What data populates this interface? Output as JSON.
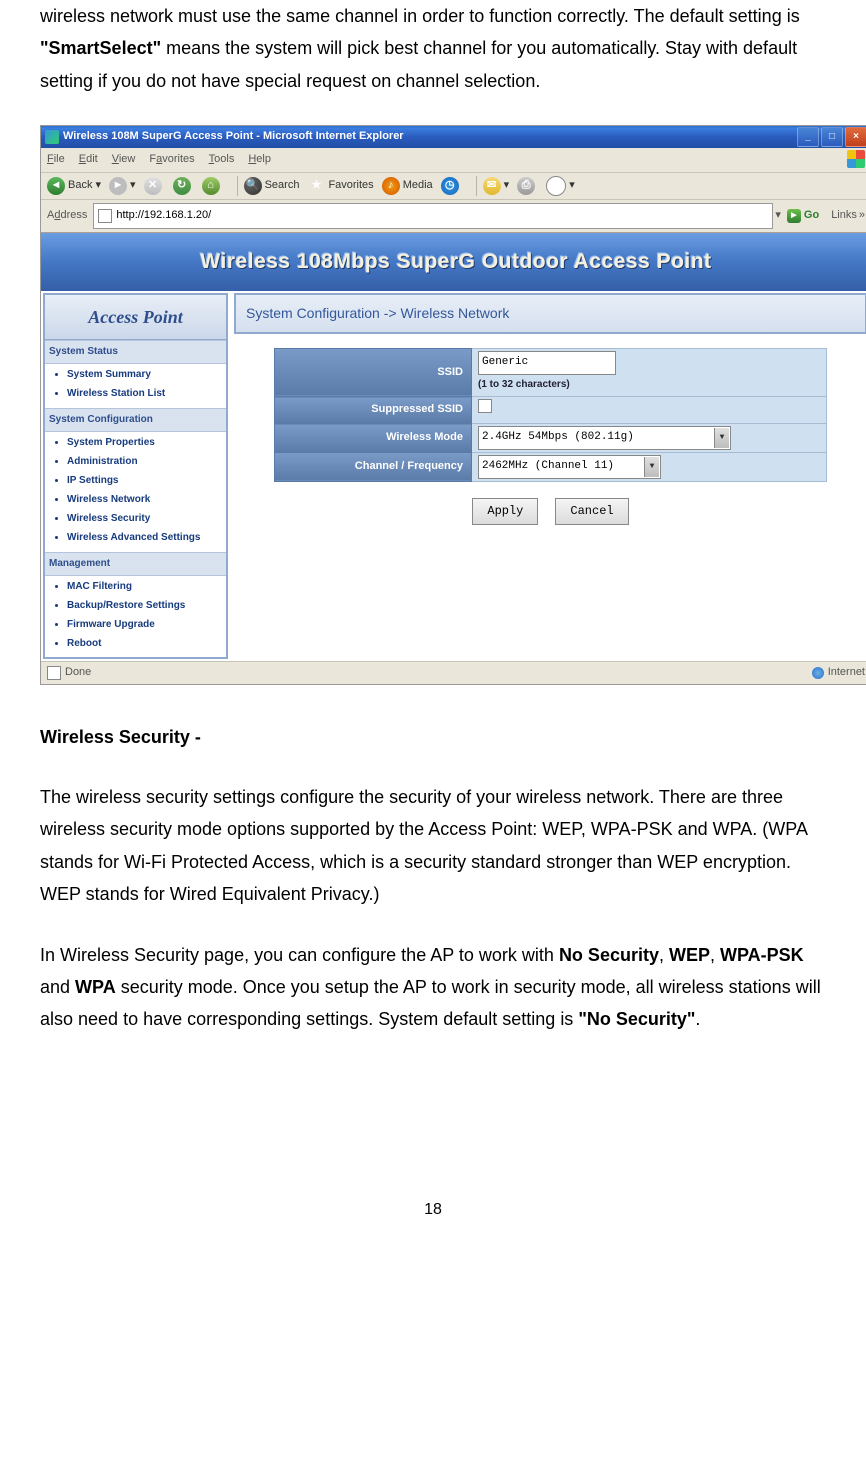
{
  "doc": {
    "intro_pre": "wireless network must use the same channel in order to function correctly. The default setting is ",
    "intro_bold1": "\"SmartSelect\"",
    "intro_post": " means the system will pick best channel for you automatically. Stay with default setting if you do not have special request on channel selection.",
    "heading": "Wireless Security -",
    "para2": "The wireless security settings configure the security of your wireless network. There are three wireless security mode options supported by the Access Point: WEP, WPA-PSK and WPA. (WPA stands for Wi-Fi Protected Access, which is a security standard stronger than WEP encryption. WEP stands for Wired Equivalent Privacy.)",
    "para3_pre": "In Wireless Security page, you can configure the AP to work with ",
    "para3_b1": "No Security",
    "para3_s1": ", ",
    "para3_b2": "WEP",
    "para3_s2": ", ",
    "para3_b3": "WPA-PSK",
    "para3_s3": " and ",
    "para3_b4": "WPA",
    "para3_mid": " security mode. Once you setup the AP to work in security mode, all wireless stations will also need to have corresponding settings. System default setting is ",
    "para3_b5": "\"No Security\"",
    "para3_end": ".",
    "page_number": "18"
  },
  "browser": {
    "title": "Wireless 108M SuperG Access Point - Microsoft Internet Explorer",
    "menu": {
      "file": "File",
      "edit": "Edit",
      "view": "View",
      "favorites": "Favorites",
      "tools": "Tools",
      "help": "Help"
    },
    "toolbar": {
      "back": "Back",
      "search": "Search",
      "favorites": "Favorites",
      "media": "Media"
    },
    "address_label": "Address",
    "url": "http://192.168.1.20/",
    "go": "Go",
    "links": "Links",
    "status_left": "Done",
    "status_right": "Internet"
  },
  "ap": {
    "banner": "Wireless 108Mbps SuperG Outdoor Access Point",
    "sidebar_title": "Access Point",
    "cat1": "System Status",
    "cat1_items": [
      "System Summary",
      "Wireless Station List"
    ],
    "cat2": "System Configuration",
    "cat2_items": [
      "System Properties",
      "Administration",
      "IP Settings",
      "Wireless Network",
      "Wireless Security",
      "Wireless Advanced Settings"
    ],
    "cat3": "Management",
    "cat3_items": [
      "MAC Filtering",
      "Backup/Restore Settings",
      "Firmware Upgrade",
      "Reboot"
    ],
    "breadcrumb": "System Configuration -> Wireless Network",
    "form": {
      "ssid_label": "SSID",
      "ssid_value": "Generic",
      "ssid_hint": "(1 to 32 characters)",
      "suppressed_label": "Suppressed SSID",
      "mode_label": "Wireless Mode",
      "mode_value": "2.4GHz 54Mbps (802.11g)",
      "channel_label": "Channel / Frequency",
      "channel_value": "2462MHz (Channel 11)",
      "apply": "Apply",
      "cancel": "Cancel"
    }
  }
}
